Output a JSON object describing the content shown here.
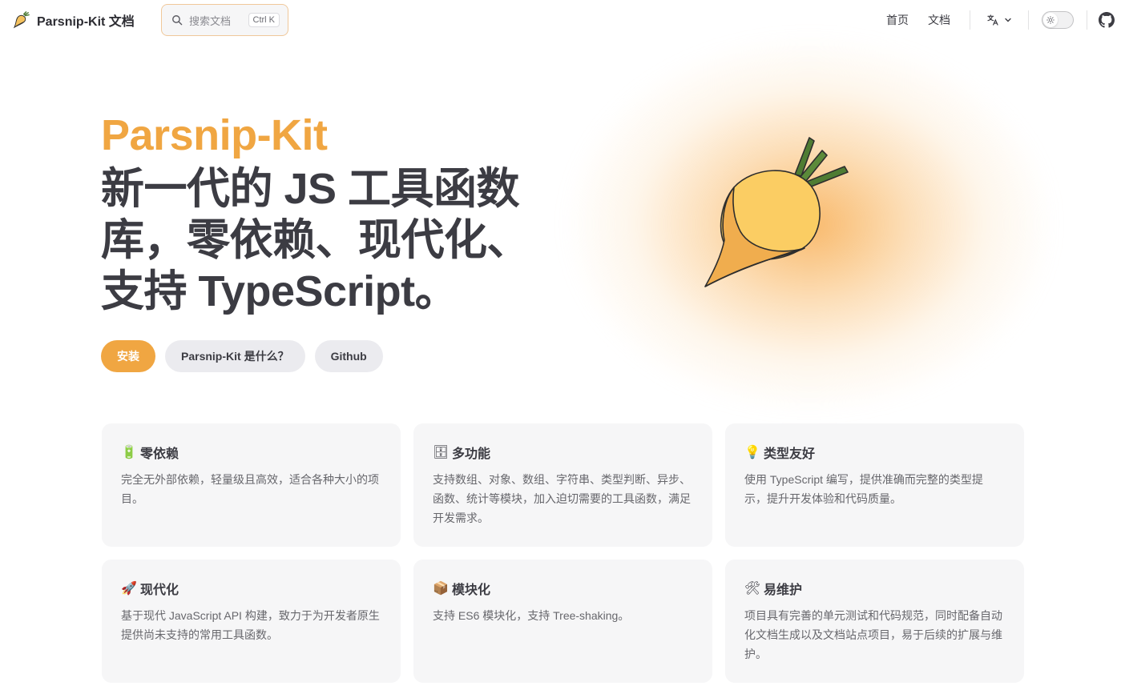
{
  "brand": {
    "title": "Parsnip-Kit 文档",
    "logo_icon": "parsnip-logo-icon"
  },
  "search": {
    "placeholder": "搜索文档",
    "shortcut": "Ctrl K"
  },
  "nav": {
    "links": [
      {
        "label": "首页"
      },
      {
        "label": "文档"
      }
    ],
    "language_icon": "translate-icon",
    "theme_icon": "sun-icon",
    "github_icon": "github-icon"
  },
  "hero": {
    "name": "Parsnip-Kit",
    "text": "新一代的 JS 工具函数库，零依赖、现代化、支持 TypeScript。",
    "actions": [
      {
        "label": "安装",
        "theme": "brand"
      },
      {
        "label": "Parsnip-Kit 是什么？",
        "theme": "alt"
      },
      {
        "label": "Github",
        "theme": "alt"
      }
    ],
    "accent_color": "#f0a642"
  },
  "features": [
    {
      "icon": "🔋",
      "title": "零依赖",
      "details": "完全无外部依赖，轻量级且高效，适合各种大小的项目。"
    },
    {
      "icon": "🗄",
      "title": "多功能",
      "details": "支持数组、对象、数组、字符串、类型判断、异步、函数、统计等模块，加入迫切需要的工具函数，满足开发需求。"
    },
    {
      "icon": "💡",
      "title": "类型友好",
      "details": "使用 TypeScript 编写，提供准确而完整的类型提示，提升开发体验和代码质量。"
    },
    {
      "icon": "🚀",
      "title": "现代化",
      "details": "基于现代 JavaScript API 构建，致力于为开发者原生提供尚未支持的常用工具函数。"
    },
    {
      "icon": "📦",
      "title": "模块化",
      "details": "支持 ES6 模块化，支持 Tree-shaking。"
    },
    {
      "icon": "🛠",
      "title": "易维护",
      "details": "项目具有完善的单元测试和代码规范，同时配备自动化文档生成以及文档站点项目，易于后续的扩展与维护。"
    }
  ]
}
